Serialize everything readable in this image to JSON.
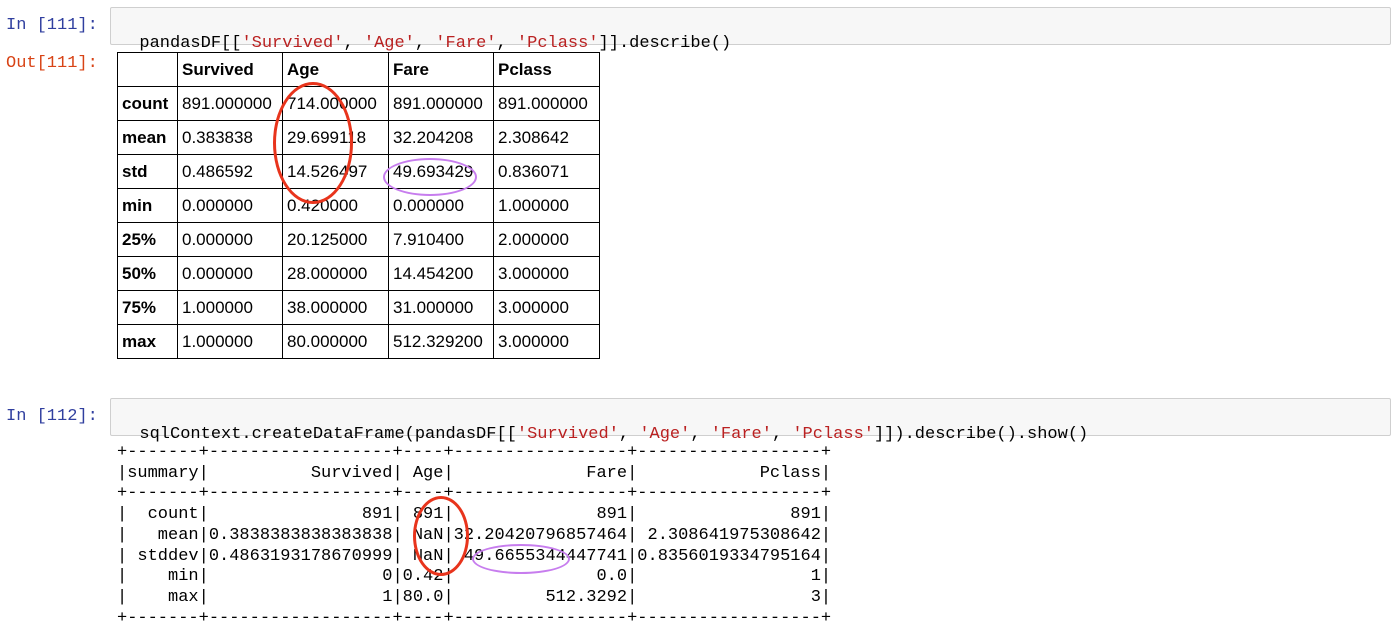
{
  "cell1": {
    "in_prompt": "In [111]:",
    "out_prompt": "Out[111]:",
    "code": [
      {
        "t": "pandasDF[[",
        "s": false
      },
      {
        "t": "'Survived'",
        "s": true
      },
      {
        "t": ", ",
        "s": false
      },
      {
        "t": "'Age'",
        "s": true
      },
      {
        "t": ", ",
        "s": false
      },
      {
        "t": "'Fare'",
        "s": true
      },
      {
        "t": ", ",
        "s": false
      },
      {
        "t": "'Pclass'",
        "s": true
      },
      {
        "t": "]].describe()",
        "s": false
      }
    ],
    "table": {
      "columns": [
        "Survived",
        "Age",
        "Fare",
        "Pclass"
      ],
      "rows": [
        {
          "label": "count",
          "values": [
            "891.000000",
            "714.000000",
            "891.000000",
            "891.000000"
          ]
        },
        {
          "label": "mean",
          "values": [
            "0.383838",
            "29.699118",
            "32.204208",
            "2.308642"
          ]
        },
        {
          "label": "std",
          "values": [
            "0.486592",
            "14.526497",
            "49.693429",
            "0.836071"
          ]
        },
        {
          "label": "min",
          "values": [
            "0.000000",
            "0.420000",
            "0.000000",
            "1.000000"
          ]
        },
        {
          "label": "25%",
          "values": [
            "0.000000",
            "20.125000",
            "7.910400",
            "2.000000"
          ]
        },
        {
          "label": "50%",
          "values": [
            "0.000000",
            "28.000000",
            "14.454200",
            "3.000000"
          ]
        },
        {
          "label": "75%",
          "values": [
            "1.000000",
            "38.000000",
            "31.000000",
            "3.000000"
          ]
        },
        {
          "label": "max",
          "values": [
            "1.000000",
            "80.000000",
            "512.329200",
            "3.000000"
          ]
        }
      ]
    }
  },
  "cell2": {
    "in_prompt": "In [112]:",
    "code": [
      {
        "t": "sqlContext.createDataFrame(pandasDF[[",
        "s": false
      },
      {
        "t": "'Survived'",
        "s": true
      },
      {
        "t": ", ",
        "s": false
      },
      {
        "t": "'Age'",
        "s": true
      },
      {
        "t": ", ",
        "s": false
      },
      {
        "t": "'Fare'",
        "s": true
      },
      {
        "t": ", ",
        "s": false
      },
      {
        "t": "'Pclass'",
        "s": true
      },
      {
        "t": "]]).describe().show()",
        "s": false
      }
    ],
    "output_lines": [
      "+-------+------------------+----+-----------------+------------------+",
      "|summary|          Survived| Age|             Fare|            Pclass|",
      "+-------+------------------+----+-----------------+------------------+",
      "|  count|               891| 891|              891|               891|",
      "|   mean|0.3838383838383838| NaN|32.20420796857464| 2.308641975308642|",
      "| stddev|0.4863193178670999| NaN| 49.6655344447741|0.8356019334795164|",
      "|    min|                 0|0.42|              0.0|                 1|",
      "|    max|                 1|80.0|         512.3292|                 3|",
      "+-------+------------------+----+-----------------+------------------+"
    ]
  },
  "annotation_colors": {
    "red": "#e8341c",
    "purple": "#c77dee"
  }
}
